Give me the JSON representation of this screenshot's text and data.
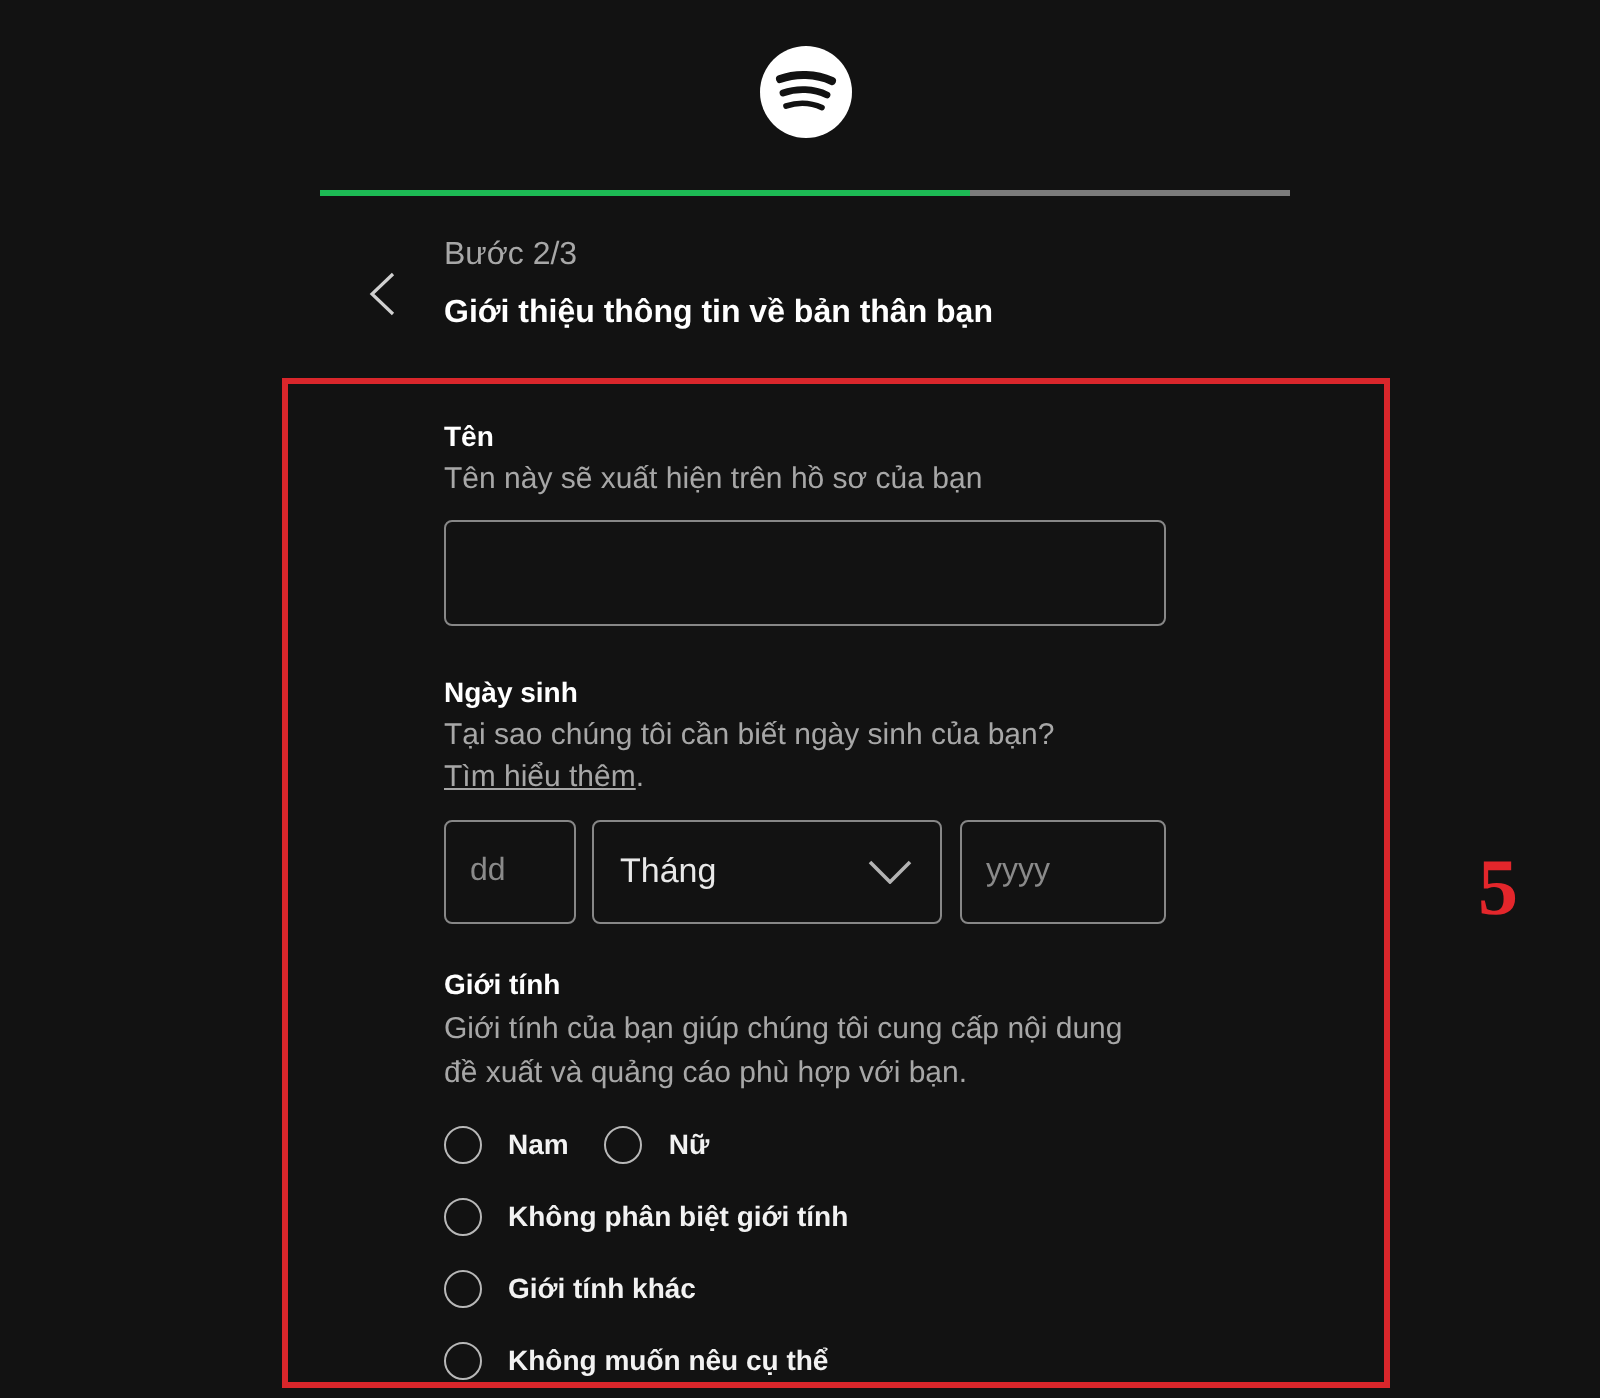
{
  "progress": {
    "level": 0.67
  },
  "header": {
    "step": "Bước 2/3",
    "title": "Giới thiệu thông tin về bản thân bạn"
  },
  "form": {
    "sections": [
      {
        "kind": "text",
        "label": "Tên",
        "hint": "Tên này sẽ xuất hiện trên hồ sơ của bạn"
      },
      {
        "kind": "date",
        "label": "Ngày sinh",
        "hint": "Tại sao chúng tôi cần biết ngày sinh của bạn?",
        "link": "Tìm hiểu thêm",
        "hint_end": ".",
        "day": {
          "placeholder": "dd"
        },
        "month": {
          "value": "Tháng"
        },
        "year": {
          "placeholder": "yyyy"
        }
      },
      {
        "kind": "radio",
        "label": "Giới tính",
        "hint": "Giới tính của bạn giúp chúng tôi cung cấp nội dung đề xuất và quảng cáo phù hợp với bạn.",
        "option_rows": [
          [
            {
              "label": "Nam",
              "selected": false
            },
            {
              "label": "Nữ",
              "selected": false
            }
          ],
          [
            {
              "label": "Không phân biệt giới tính",
              "selected": false
            }
          ],
          [
            {
              "label": "Giới tính khác",
              "selected": false
            }
          ],
          [
            {
              "label": "Không muốn nêu cụ thể",
              "selected": false
            }
          ]
        ]
      }
    ]
  },
  "annotation": {
    "label": "5"
  }
}
